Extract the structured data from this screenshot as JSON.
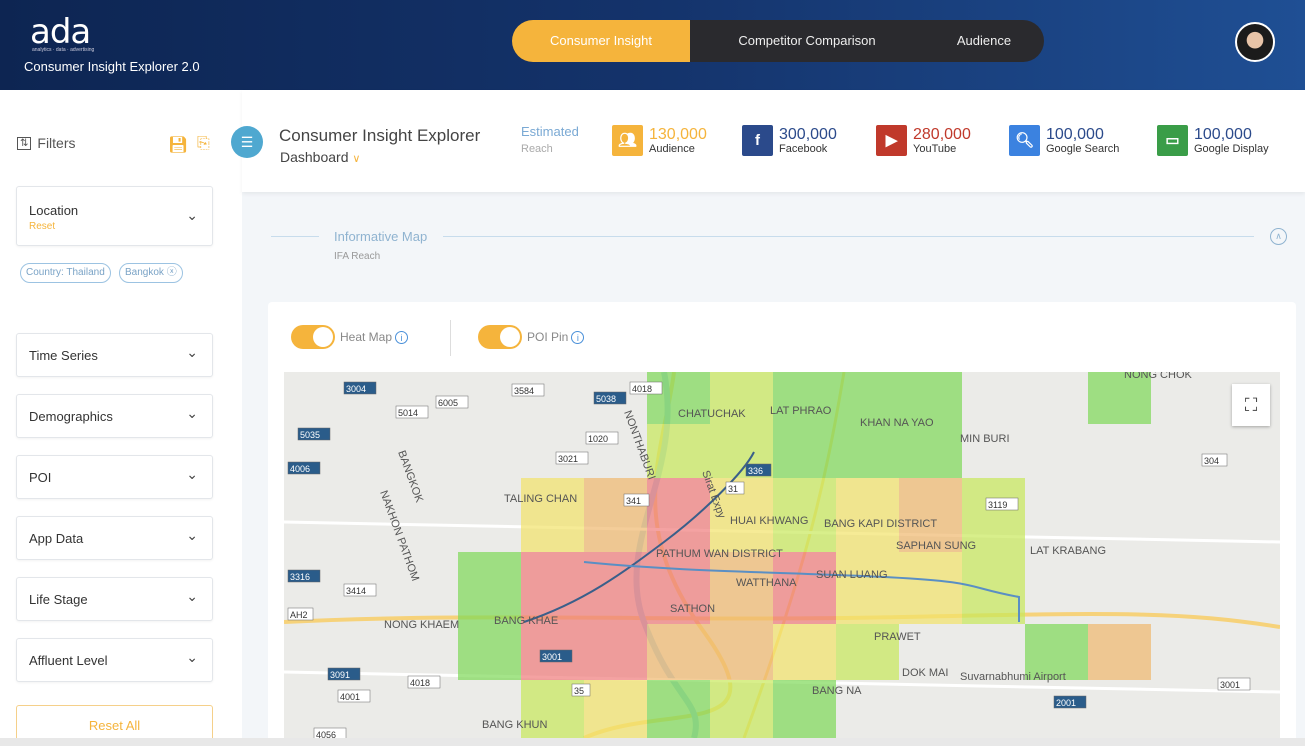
{
  "header": {
    "logo": "ada",
    "logo_tagline": "analytics · data · advertising",
    "app_title": "Consumer Insight Explorer 2.0",
    "nav": [
      {
        "label": "Consumer Insight",
        "active": true
      },
      {
        "label": "Competitor Comparison"
      },
      {
        "label": "Audience"
      }
    ]
  },
  "sidebar": {
    "title": "Filters",
    "location": {
      "label": "Location",
      "reset": "Reset"
    },
    "chips": [
      "Country: Thailand",
      "Bangkok"
    ],
    "filters": [
      "Time Series",
      "Demographics",
      "POI",
      "App Data",
      "Life Stage",
      "Affluent Level"
    ],
    "reset_all": "Reset All"
  },
  "topbar": {
    "title": "Consumer Insight Explorer",
    "subtitle": "Dashboard",
    "estimated": "Estimated",
    "reach": "Reach",
    "stats": [
      {
        "value": "130,000",
        "name": "Audience",
        "icon": "audience-icon",
        "color": "#f5b43c",
        "text_color": "#f5b43c"
      },
      {
        "value": "300,000",
        "name": "Facebook",
        "icon": "facebook-icon",
        "color": "#2b4a8b",
        "text_color": "#2b4a8b"
      },
      {
        "value": "280,000",
        "name": "YouTube",
        "icon": "youtube-icon",
        "color": "#c0392b",
        "text_color": "#c0392b"
      },
      {
        "value": "100,000",
        "name": "Google Search",
        "icon": "search-icon",
        "color": "#3b82e0",
        "text_color": "#2b4a8b"
      },
      {
        "value": "100,000",
        "name": "Google Display",
        "icon": "display-icon",
        "color": "#3a9d48",
        "text_color": "#2b4a8b"
      }
    ]
  },
  "section": {
    "title": "Informative Map",
    "subtitle": "IFA Reach"
  },
  "map": {
    "heat_map": "Heat Map",
    "poi_pin": "POI Pin",
    "labels": [
      "CHATUCHAK",
      "LAT PHRAO",
      "KHAN NA YAO",
      "MIN BURI",
      "NONG CHOK",
      "TALING CHAN",
      "HUAI KHWANG",
      "BANG KAPI DISTRICT",
      "SAPHAN SUNG",
      "LAT KRABANG",
      "PATHUM WAN DISTRICT",
      "WATTHANA",
      "SUAN LUANG",
      "SATHON",
      "BANG KHAE",
      "NONG KHAEM",
      "PRAWET",
      "DOK MAI",
      "Suvarnabhumi Airport",
      "BANG NA",
      "BANG KHUN",
      "NAKHON PATHOM",
      "BANGKOK",
      "NONTHABURI",
      "Sirat Expy"
    ],
    "roads": [
      "3004",
      "3584",
      "4018",
      "5038",
      "5014",
      "6005",
      "5035",
      "1020",
      "3021",
      "4006",
      "341",
      "31",
      "336",
      "3119",
      "304",
      "3316",
      "3414",
      "AH2",
      "3091",
      "4001",
      "4018",
      "3001",
      "35",
      "4056",
      "2001",
      "3001"
    ]
  }
}
